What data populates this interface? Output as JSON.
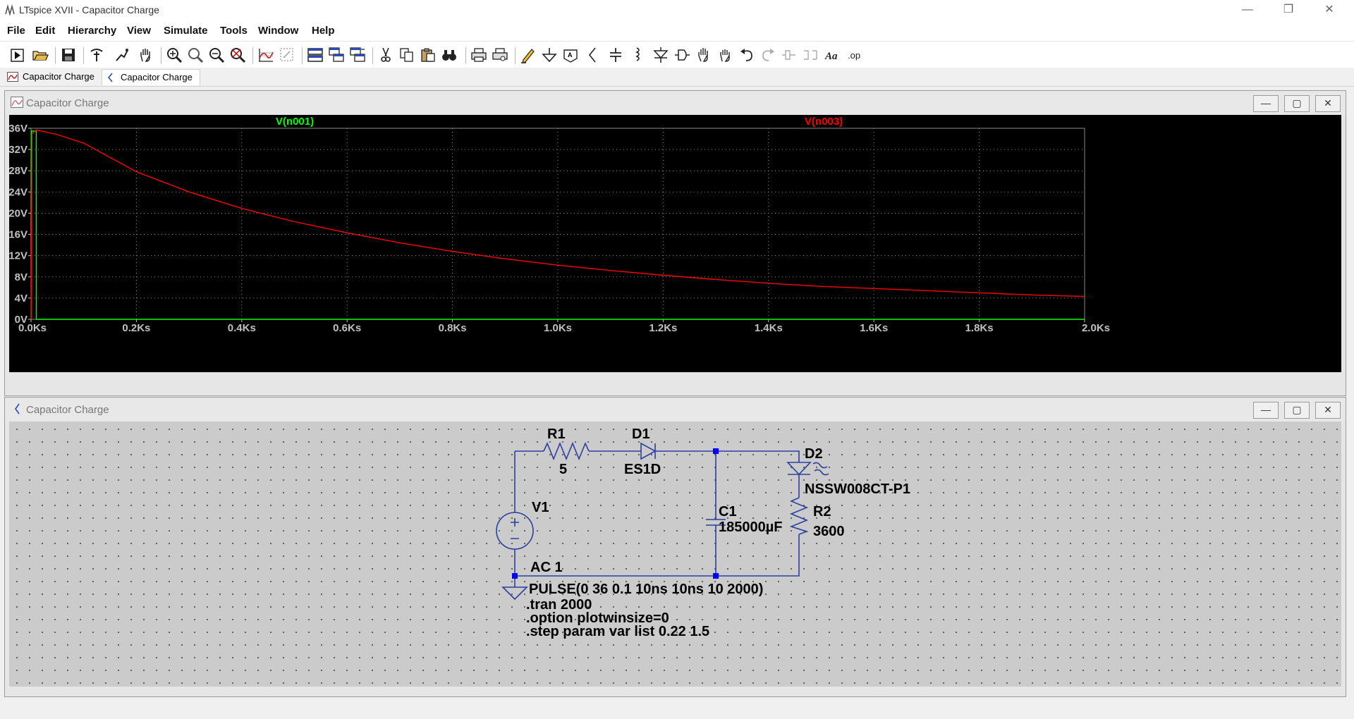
{
  "window": {
    "title": "LTspice XVII - Capacitor Charge",
    "controls": {
      "minimize": "—",
      "restore": "❐",
      "close": "✕"
    }
  },
  "menu": [
    "File",
    "Edit",
    "Hierarchy",
    "View",
    "Simulate",
    "Tools",
    "Window",
    "Help"
  ],
  "toolbar_icons": [
    "run-icon",
    "open-icon",
    "save-icon",
    "control-panel-icon",
    "halt-icon",
    "pan-icon",
    "zoom-in-icon",
    "zoom-area-icon",
    "zoom-out-icon",
    "zoom-fit-icon",
    "autorange-icon",
    "mark-unref-icon",
    "tile-horizontal-icon",
    "cascade-icon",
    "tile-vertical-icon",
    "cut-icon",
    "copy-icon",
    "paste-icon",
    "find-icon",
    "print-icon",
    "print-preview-icon",
    "draw-wire-icon",
    "ground-icon",
    "label-net-icon",
    "resistor-icon",
    "capacitor-icon",
    "inductor-icon",
    "diode-icon",
    "component-icon",
    "move-icon",
    "drag-icon",
    "undo-icon",
    "redo-icon",
    "rotate-icon",
    "mirror-icon",
    "text-icon",
    "spice-directive-icon"
  ],
  "tabs": [
    {
      "label": "Capacitor Charge",
      "icon": "waveform-icon"
    },
    {
      "label": "Capacitor Charge",
      "icon": "schematic-icon"
    }
  ],
  "waveform_window": {
    "title": "Capacitor Charge",
    "controls": {
      "minimize": "—",
      "maximize": "▢",
      "close": "✕"
    },
    "trace_labels": [
      {
        "name": "V(n001)",
        "color": "#00ff00"
      },
      {
        "name": "V(n003)",
        "color": "#ff0000"
      }
    ]
  },
  "schematic_window": {
    "title": "Capacitor Charge",
    "controls": {
      "minimize": "—",
      "maximize": "▢",
      "close": "✕"
    },
    "components": {
      "r1": {
        "name": "R1",
        "value": "5"
      },
      "d1": {
        "name": "D1",
        "value": "ES1D"
      },
      "d2": {
        "name": "D2",
        "value": "NSSW008CT-P1"
      },
      "v1": {
        "name": "V1",
        "value": "AC 1"
      },
      "c1": {
        "name": "C1",
        "value": "185000µF"
      },
      "r2": {
        "name": "R2",
        "value": "3600"
      }
    },
    "directives": [
      "PULSE(0 36 0.1 10ns 10ns 10 2000)",
      ".tran 2000",
      ".option plotwinsize=0",
      ".step param var list 0.22 1.5"
    ]
  },
  "chart_data": {
    "type": "line",
    "title": "",
    "xlabel": "",
    "ylabel": "",
    "x_ticks": [
      "0.0Ks",
      "0.2Ks",
      "0.4Ks",
      "0.6Ks",
      "0.8Ks",
      "1.0Ks",
      "1.2Ks",
      "1.4Ks",
      "1.6Ks",
      "1.8Ks",
      "2.0Ks"
    ],
    "y_ticks": [
      "0V",
      "4V",
      "8V",
      "12V",
      "16V",
      "20V",
      "24V",
      "28V",
      "32V",
      "36V"
    ],
    "xlim": [
      0,
      2000
    ],
    "ylim": [
      0,
      36
    ],
    "grid": true,
    "series": [
      {
        "name": "V(n001)",
        "color": "#00ff00",
        "x": [
          0,
          0,
          0.1,
          0.2,
          1,
          1.2,
          9.9,
          10,
          10.1,
          12,
          2000
        ],
        "y": [
          0,
          0,
          0,
          30,
          35.5,
          35.5,
          35.5,
          0,
          0,
          0,
          0
        ]
      },
      {
        "name": "V(n003)",
        "color": "#ff0000",
        "x": [
          0,
          2,
          10,
          50,
          100,
          200,
          300,
          400,
          500,
          600,
          700,
          800,
          900,
          1000,
          1100,
          1200,
          1300,
          1400,
          1500,
          1600,
          1700,
          1800,
          1900,
          2000
        ],
        "y": [
          0,
          35,
          35.7,
          34.8,
          33.2,
          27.8,
          24.0,
          20.9,
          18.4,
          16.3,
          14.4,
          12.8,
          11.4,
          10.2,
          9.2,
          8.3,
          7.5,
          6.8,
          6.2,
          5.8,
          5.4,
          5.0,
          4.6,
          4.3
        ]
      }
    ]
  }
}
